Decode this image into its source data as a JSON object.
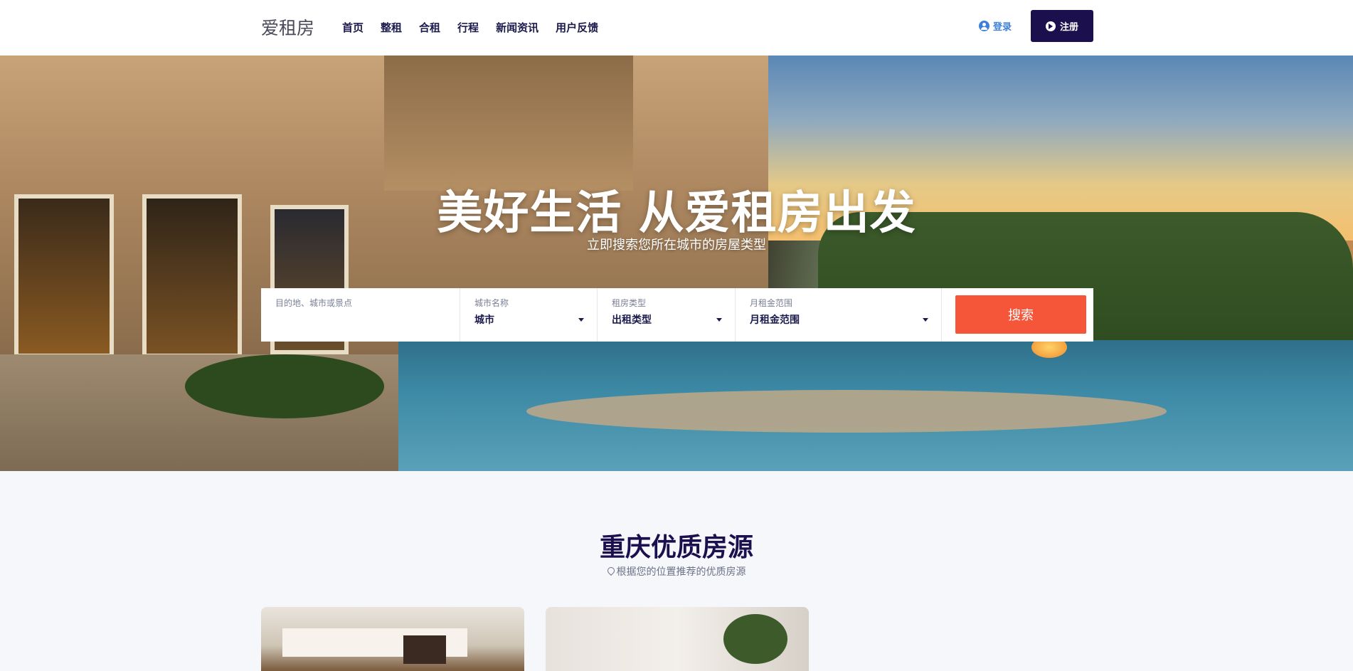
{
  "header": {
    "logo": "爱租房",
    "nav": [
      "首页",
      "整租",
      "合租",
      "行程",
      "新闻资讯",
      "用户反馈"
    ],
    "login_label": "登录",
    "register_label": "注册"
  },
  "hero": {
    "title": "美好生活 从爱租房出发",
    "subtitle": "立即搜索您所在城市的房屋类型"
  },
  "search": {
    "destination_label": "目的地、城市或景点",
    "city_label": "城市名称",
    "city_value": "城市",
    "type_label": "租房类型",
    "type_value": "出租类型",
    "price_label": "月租金范围",
    "price_value": "月租金范围",
    "button_label": "搜索"
  },
  "section": {
    "title": "重庆优质房源",
    "subtitle": "根据您的位置推荐的优质房源"
  }
}
